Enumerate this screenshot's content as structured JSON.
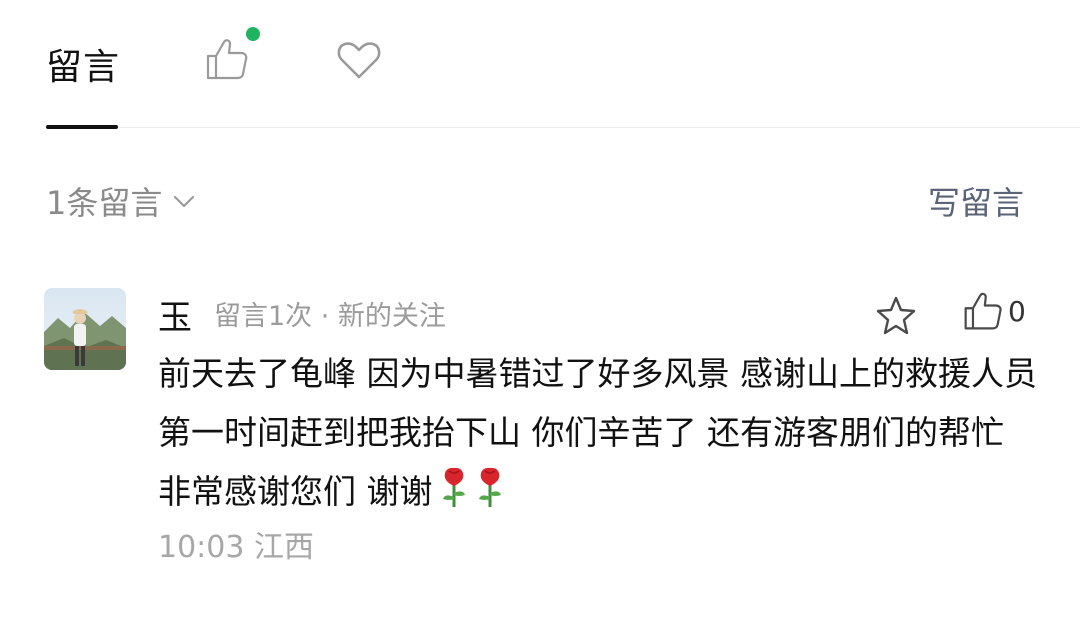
{
  "tabs": {
    "comments_label": "留言",
    "has_like_notification": true,
    "like_dot_color": "#1fb45f"
  },
  "summary": {
    "count_label": "1条留言"
  },
  "write_button": "写留言",
  "comment": {
    "name": "玉",
    "meta": "留言1次 · 新的关注",
    "like_count": "0",
    "content": "前天去了龟峰 因为中暑错过了好多风景 感谢山上的救援人员第一时间赶到把我抬下山 你们辛苦了 还有游客朋们的帮忙 非常感谢您们 谢谢",
    "emojis": [
      "rose-emoji",
      "rose-emoji"
    ],
    "time_location": "10:03  江西"
  },
  "colors": {
    "link": "#5a6378",
    "meta_gray": "#9b9b9b"
  }
}
